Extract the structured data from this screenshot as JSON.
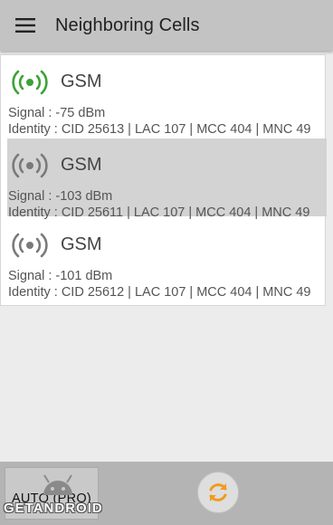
{
  "app_bar": {
    "title": "Neighboring Cells",
    "menu_icon": "hamburger-menu-icon"
  },
  "cells": [
    {
      "tech": "GSM",
      "signal": "Signal : -75 dBm",
      "identity": "Identity : CID 25613 | LAC 107 | MCC 404 | MNC 49",
      "signal_icon_color": "#3aa335",
      "selected": false
    },
    {
      "tech": "GSM",
      "signal": "Signal : -103 dBm",
      "identity": "Identity : CID 25611 | LAC 107 | MCC 404 | MNC 49",
      "signal_icon_color": "#7a7a7a",
      "selected": true
    },
    {
      "tech": "GSM",
      "signal": "Signal : -101 dBm",
      "identity": "Identity : CID 25612 | LAC 107 | MCC 404 | MNC 49",
      "signal_icon_color": "#7a7a7a",
      "selected": false
    }
  ],
  "bottom_bar": {
    "auto_label": "AUTO (PRO)",
    "refresh_icon": "refresh-icon",
    "refresh_color": "#f29a1e",
    "watermark": "GETANDROID"
  }
}
